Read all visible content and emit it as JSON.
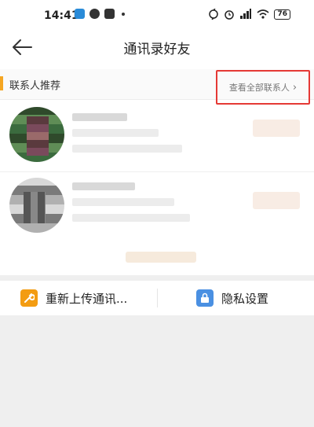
{
  "status_bar": {
    "time": "14:41",
    "battery": "76"
  },
  "header": {
    "title": "通讯录好友"
  },
  "section": {
    "title": "联系人推荐",
    "view_all_label": "查看全部联系人",
    "accent_color": "#f5a623",
    "highlight_color": "#e53935"
  },
  "contacts": [
    {
      "icon": "avatar"
    },
    {
      "icon": "avatar"
    }
  ],
  "toolbar": {
    "upload_label": "重新上传通讯...",
    "privacy_label": "隐私设置",
    "upload_icon": "wrench-icon",
    "privacy_icon": "lock-icon",
    "upload_icon_color": "#f39c12",
    "privacy_icon_color": "#4a90e2"
  }
}
